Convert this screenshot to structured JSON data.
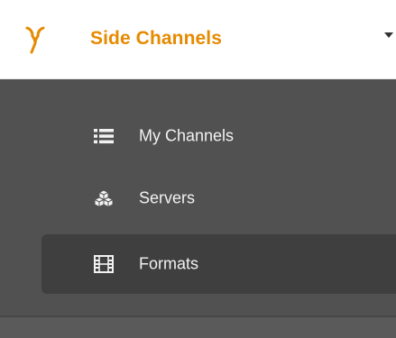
{
  "header": {
    "title": "Side Channels",
    "logo_icon": "fork-icon",
    "dropdown_icon": "caret-down-icon"
  },
  "nav": {
    "items": [
      {
        "label": "My Channels",
        "icon": "list-icon",
        "active": false
      },
      {
        "label": "Servers",
        "icon": "cubes-icon",
        "active": false
      },
      {
        "label": "Formats",
        "icon": "film-icon",
        "active": true
      }
    ]
  },
  "colors": {
    "accent": "#e68a00",
    "sidebar_bg": "#515151",
    "active_bg": "#3f3f3f",
    "text": "#f2f2f2",
    "header_bg": "#ffffff"
  }
}
